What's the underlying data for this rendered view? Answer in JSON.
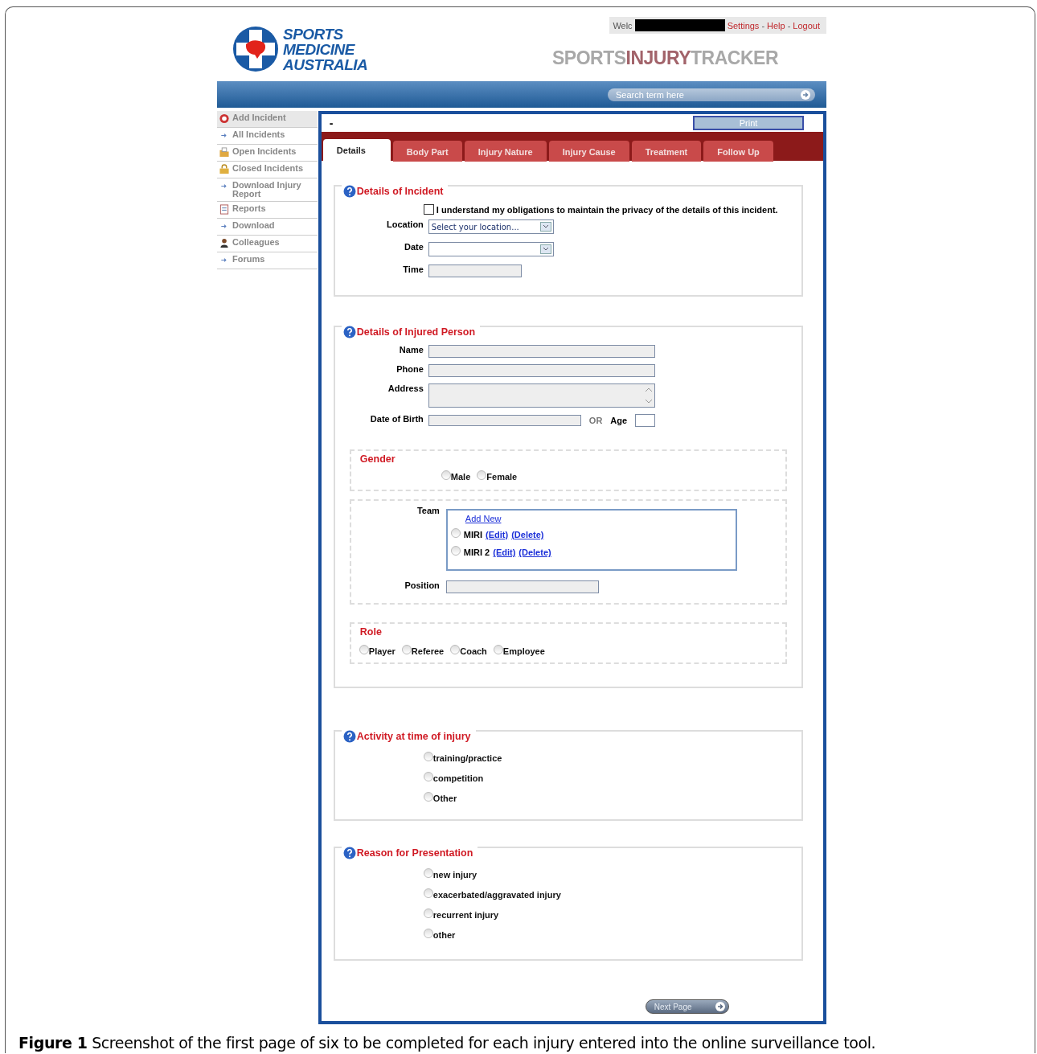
{
  "header": {
    "logo_lines": [
      "SPORTS",
      "MEDICINE",
      "AUSTRALIA"
    ],
    "welcome": "Welc",
    "links": [
      {
        "label": "Settings"
      },
      {
        "label": "Help"
      },
      {
        "label": "Logout"
      }
    ],
    "separator": "-",
    "title_parts": [
      {
        "text": "SPORTS",
        "color": "#a8a8a8"
      },
      {
        "text": "INJURY",
        "color": "#a2636a"
      },
      {
        "text": "TRACKER",
        "color": "#a8a8a8"
      }
    ]
  },
  "search": {
    "placeholder": "Search term here"
  },
  "sidebar": {
    "items": [
      {
        "label": "Add Incident",
        "kind": "plus",
        "selected": true
      },
      {
        "label": "All Incidents",
        "kind": "arrow",
        "selected": false
      },
      {
        "label": "Open Incidents",
        "kind": "folder",
        "selected": false
      },
      {
        "label": "Closed Incidents",
        "kind": "lock",
        "selected": false
      },
      {
        "label": "Download Injury Report",
        "kind": "arrow",
        "selected": false
      },
      {
        "label": "Reports",
        "kind": "report",
        "selected": false
      },
      {
        "label": "Download",
        "kind": "arrow",
        "selected": false
      },
      {
        "label": "Colleagues",
        "kind": "person",
        "selected": false
      },
      {
        "label": "Forums",
        "kind": "arrow",
        "selected": false
      }
    ]
  },
  "main": {
    "dash": "-",
    "print_button": "Print",
    "tabs": [
      {
        "label": "Details",
        "selected": true
      },
      {
        "label": "Body Part",
        "selected": false
      },
      {
        "label": "Injury Nature",
        "selected": false
      },
      {
        "label": "Injury Cause",
        "selected": false
      },
      {
        "label": "Treatment",
        "selected": false
      },
      {
        "label": "Follow Up",
        "selected": false
      }
    ],
    "incident": {
      "title": "Details of Incident",
      "consent": {
        "label": "I understand my obligations to maintain the privacy of the details of this incident.",
        "checked": false
      },
      "fields": [
        {
          "label": "Location",
          "kind": "select",
          "placeholder": "Select your location..."
        },
        {
          "label": "Date",
          "kind": "select"
        },
        {
          "label": "Time",
          "kind": "short"
        }
      ]
    },
    "person": {
      "title": "Details of Injured Person",
      "fields": [
        {
          "label": "Name",
          "kind": "long"
        },
        {
          "label": "Phone",
          "kind": "long"
        },
        {
          "label": "Address",
          "kind": "area"
        }
      ],
      "dob": {
        "label": "Date of Birth",
        "or": "OR",
        "age_label": "Age"
      },
      "gender": {
        "title": "Gender",
        "options": [
          {
            "label": "Male",
            "selected": false
          },
          {
            "label": "Female",
            "selected": false
          }
        ]
      },
      "team": {
        "label": "Team",
        "add_new": "Add New",
        "teams": [
          {
            "name": "MIRI",
            "edit": "(Edit)",
            "delete": "(Delete)",
            "selected": false
          },
          {
            "name": "MIRI 2",
            "edit": "(Edit)",
            "delete": "(Delete)",
            "selected": false
          }
        ],
        "position_label": "Position"
      },
      "role": {
        "title": "Role",
        "options": [
          {
            "label": "Player",
            "selected": false
          },
          {
            "label": "Referee",
            "selected": false
          },
          {
            "label": "Coach",
            "selected": false
          },
          {
            "label": "Employee",
            "selected": false
          }
        ]
      }
    },
    "activity": {
      "title": "Activity at time of injury",
      "options": [
        {
          "label": "training/practice",
          "selected": false
        },
        {
          "label": "competition",
          "selected": false
        },
        {
          "label": "Other",
          "selected": false
        }
      ]
    },
    "reason": {
      "title": "Reason for Presentation",
      "options": [
        {
          "label": "new injury",
          "selected": false
        },
        {
          "label": "exacerbated/aggravated injury",
          "selected": false
        },
        {
          "label": "recurrent injury",
          "selected": false
        },
        {
          "label": "other",
          "selected": false
        }
      ]
    },
    "next_button": "Next Page"
  },
  "caption": "**Figure 1** Screenshot of the first page of six to be completed for each injury entered into the online surveillance tool."
}
